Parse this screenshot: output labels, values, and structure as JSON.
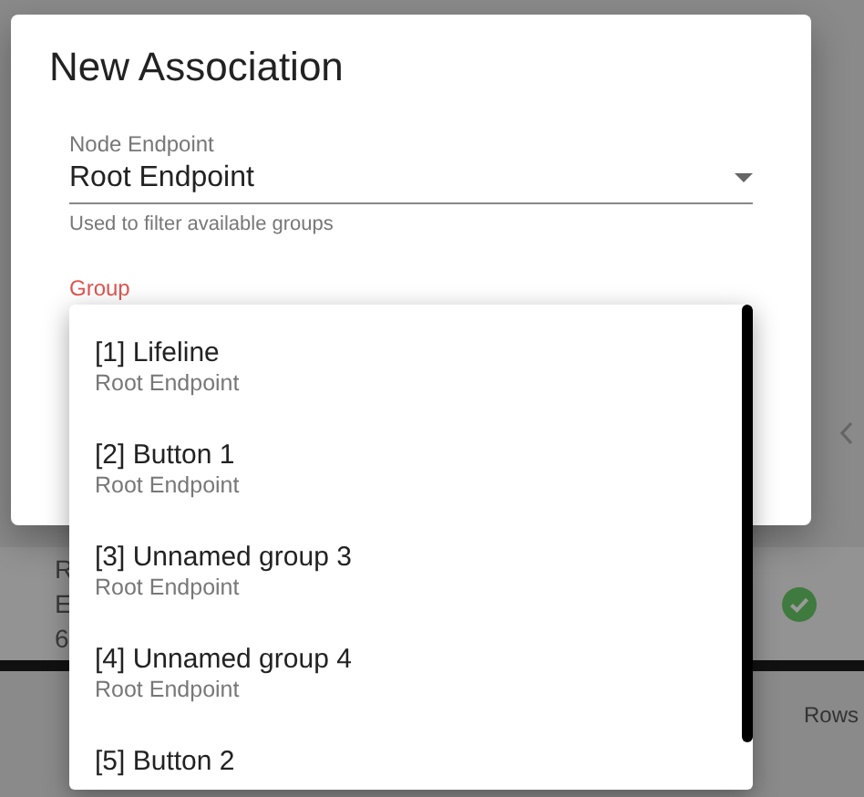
{
  "background": {
    "row_texts": [
      "R",
      "E",
      "6"
    ],
    "footer_label": "Rows"
  },
  "dialog": {
    "title": "New Association",
    "node_endpoint": {
      "label": "Node Endpoint",
      "value": "Root Endpoint",
      "helper": "Used to filter available groups"
    },
    "group": {
      "label": "Group",
      "focused": true
    }
  },
  "group_menu": {
    "items": [
      {
        "name": "[1] Lifeline",
        "endpoint": "Root Endpoint"
      },
      {
        "name": "[2] Button 1",
        "endpoint": "Root Endpoint"
      },
      {
        "name": "[3] Unnamed group 3",
        "endpoint": "Root Endpoint"
      },
      {
        "name": "[4] Unnamed group 4",
        "endpoint": "Root Endpoint"
      },
      {
        "name": "[5] Button 2"
      }
    ]
  }
}
